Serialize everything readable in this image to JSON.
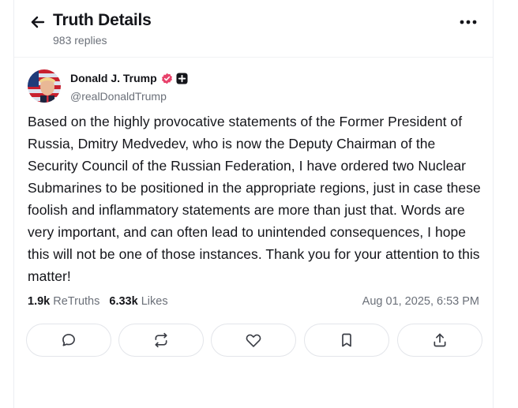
{
  "header": {
    "title": "Truth Details",
    "replies": "983 replies"
  },
  "post": {
    "author_name": "Donald J. Trump",
    "handle": "@realDonaldTrump",
    "text": "Based on the highly provocative statements of the Former President of Russia, Dmitry Medvedev, who is now the Deputy Chairman of the Security Council of the Russian Federation, I have ordered two Nuclear Submarines to be positioned in the appropriate regions, just in case these foolish and inflammatory statements are more than just that. Words are very important, and can often lead to unintended consequences, I hope this will not be one of those instances. Thank you for your attention to this matter!",
    "retruths_count": "1.9k",
    "retruths_label": "ReTruths",
    "likes_count": "6.33k",
    "likes_label": "Likes",
    "timestamp": "Aug 01, 2025, 6:53 PM"
  },
  "icons": {
    "back": "arrow-left-icon",
    "more": "more-horizontal-icon",
    "verified": "verified-badge-icon",
    "plus": "plus-badge-icon",
    "reply": "reply-bubble-icon",
    "retruth": "retruth-icon",
    "like": "heart-icon",
    "bookmark": "bookmark-icon",
    "share": "share-icon"
  },
  "colors": {
    "verified": "#e8426b",
    "text": "#14151a",
    "muted": "#6b7079",
    "border": "#e3e5ea"
  }
}
